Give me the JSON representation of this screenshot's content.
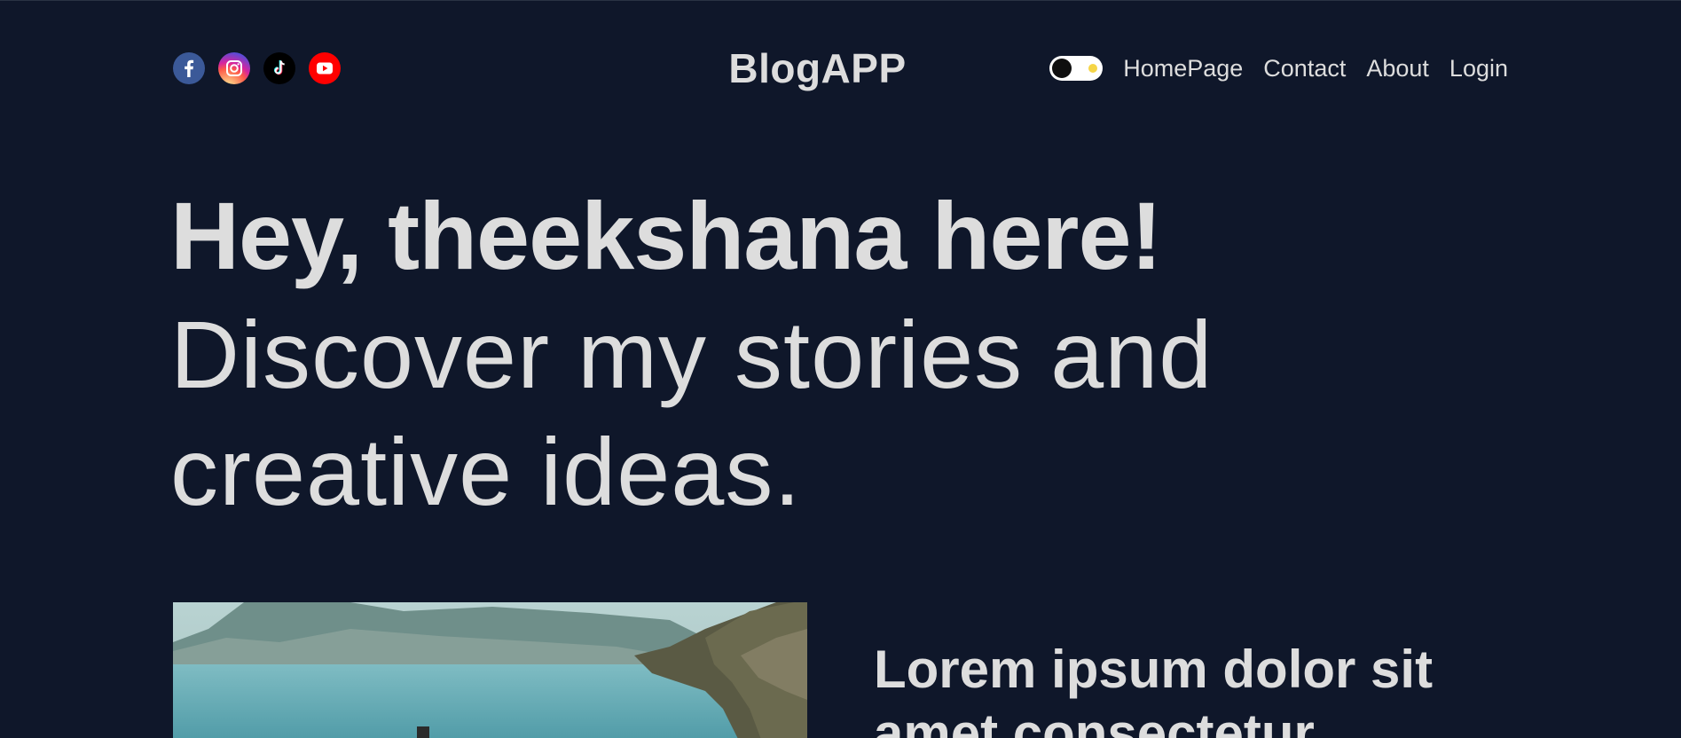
{
  "navbar": {
    "logo": "BlogAPP",
    "social_icons": [
      {
        "name": "facebook-icon",
        "color": "#3b5998"
      },
      {
        "name": "instagram-icon",
        "color": "#d6249f"
      },
      {
        "name": "tiktok-icon",
        "color": "#000000"
      },
      {
        "name": "youtube-icon",
        "color": "#ff0000"
      }
    ],
    "theme_toggle": {
      "state": "dark"
    },
    "links": {
      "homepage": "HomePage",
      "contact": "Contact",
      "about": "About",
      "login": "Login"
    }
  },
  "hero": {
    "title": "Hey, theekshana here!",
    "subtitle": "Discover my stories and creative ideas."
  },
  "featured_post": {
    "title": "Lorem ipsum dolor sit amet consectetur"
  },
  "colors": {
    "background": "#0f172a",
    "text": "#dddddd",
    "toggle_accent": "#f5d547"
  }
}
